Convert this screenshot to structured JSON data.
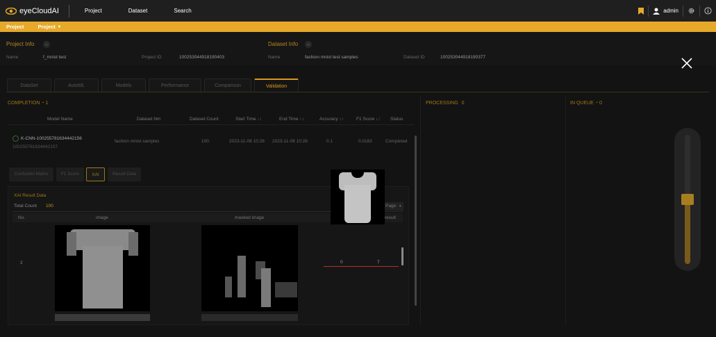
{
  "app": {
    "name": "eyeCloudAI"
  },
  "nav": [
    "Project",
    "Dataset",
    "Search"
  ],
  "user": {
    "name": "admin"
  },
  "breadcrumb": {
    "root": "Project",
    "current": "Project"
  },
  "project_info": {
    "title": "Project Info",
    "name_label": "Name",
    "name": "f_mnist test",
    "id_label": "Project ID",
    "id": "100253044918190403"
  },
  "dataset_info": {
    "title": "Dataset Info",
    "name_label": "Name",
    "name": "fashion mnist test samples",
    "id_label": "Dataset ID",
    "id": "100253044918190377"
  },
  "tabs": [
    "DataSet",
    "AutoML",
    "Models",
    "Performance",
    "Comparison",
    "Validation"
  ],
  "active_tab": "Validation",
  "completion": {
    "label": "COMPLETION",
    "count": "1"
  },
  "processing": {
    "label": "PROCESSING",
    "count": "0"
  },
  "in_queue": {
    "label": "IN QUEUE",
    "count": "0"
  },
  "table": {
    "headers": [
      "Model Name",
      "Dataset Nm",
      "Dataset Count",
      "Start Time ↓↑",
      "End Time ↑↓",
      "Accuracy ↓↑",
      "F1 Score ↓↑",
      "Status"
    ],
    "row": {
      "model_name": "K-CNN-100255781634442156",
      "model_id": "100255781634442157",
      "dataset": "fashion mnist samples",
      "count": "100",
      "start": "2023-11-08 10:28",
      "end": "2023-11-08 10:28",
      "accuracy": "0.1",
      "f1": "0.0182",
      "status": "Completed"
    }
  },
  "subtabs": [
    "Confusion Matrix",
    "F1 Score",
    "XAI",
    "Result Data"
  ],
  "active_subtab": "XAI",
  "xai": {
    "title": "XAI Result Data",
    "total_label": "Total Count",
    "total": "100",
    "page_select": "Page",
    "columns": [
      "No.",
      "image",
      "masked image",
      "result"
    ],
    "row_no": "2",
    "result_left": "0",
    "result_right": "7"
  },
  "slider": {
    "level": 0.5
  },
  "colors": {
    "accent": "#e6a92a",
    "bg": "#1a1a1a"
  }
}
